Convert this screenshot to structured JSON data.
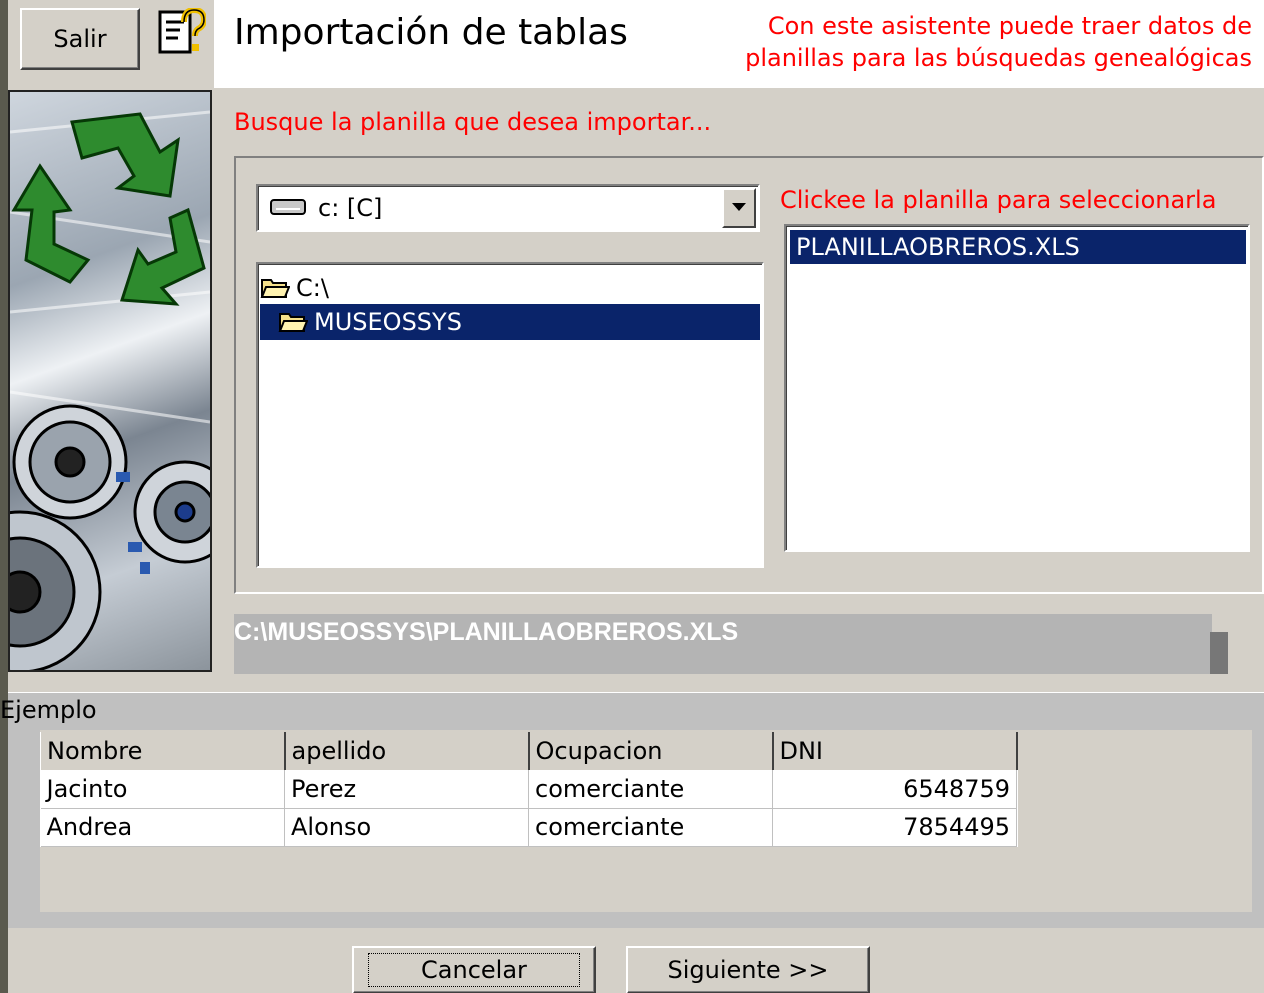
{
  "header": {
    "exit_label": "Salir",
    "title": "Importación de tablas",
    "hint_line1": "Con este asistente puede traer datos de",
    "hint_line2": "planillas para las búsquedas genealógicas"
  },
  "prompt": "Busque la planilla que desea importar...",
  "drive": {
    "selected": "c: [C]"
  },
  "directories": [
    {
      "label": "C:\\",
      "selected": false
    },
    {
      "label": "MUSEOSSYS",
      "selected": true
    }
  ],
  "files": {
    "hint": "Clickee la planilla para seleccionarla",
    "items": [
      "PLANILLAOBREROS.XLS"
    ]
  },
  "selected_path": "C:\\MUSEOSSYS\\PLANILLAOBREROS.XLS",
  "example": {
    "label": "Ejemplo",
    "columns": [
      "Nombre",
      "apellido",
      "Ocupacion",
      "DNI"
    ],
    "rows": [
      [
        "Jacinto",
        "Perez",
        "comerciante",
        "6548759"
      ],
      [
        "Andrea",
        "Alonso",
        "comerciante",
        "7854495"
      ]
    ]
  },
  "footer": {
    "cancel_label": "Cancelar",
    "next_label": "Siguiente >>"
  },
  "colors": {
    "accent_red": "#ff0000",
    "selection_blue": "#0a246a",
    "dialog_gray": "#d4d0c8"
  }
}
